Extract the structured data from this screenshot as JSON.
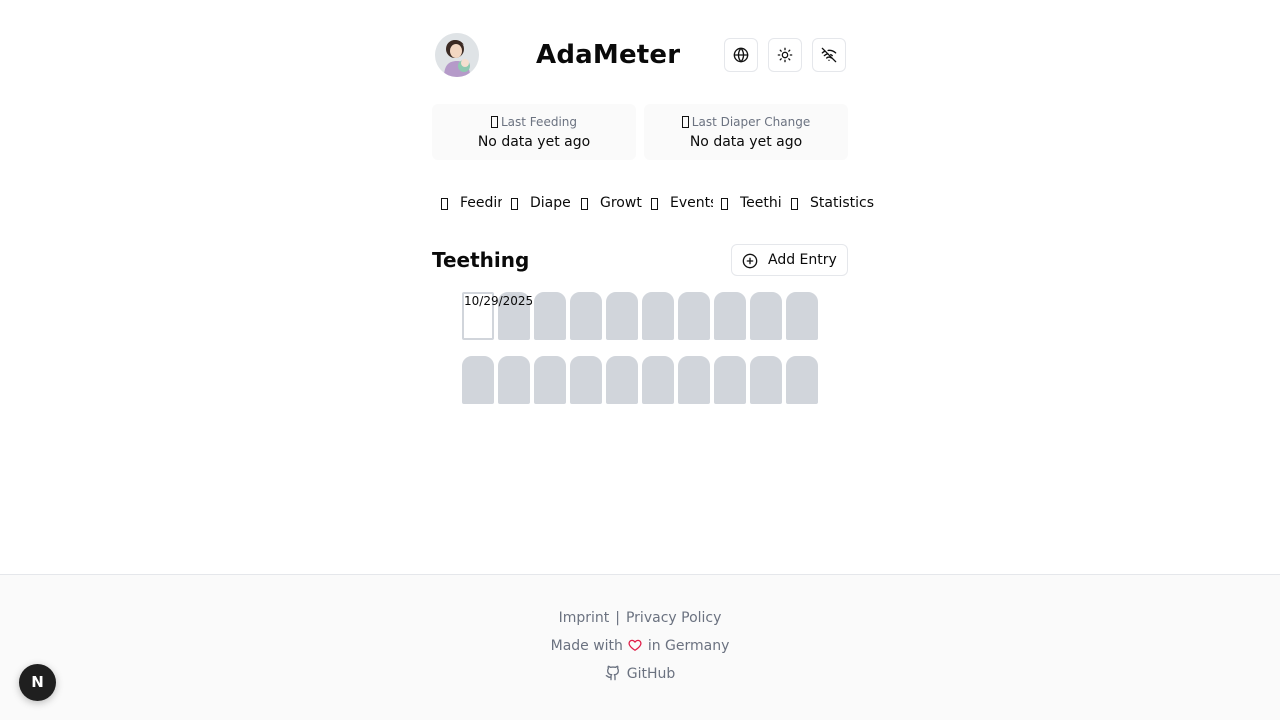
{
  "header": {
    "title": "AdaMeter",
    "avatar_icon": "mother-with-baby-avatar",
    "buttons": [
      {
        "name": "language",
        "icon": "globe-icon"
      },
      {
        "name": "theme",
        "icon": "sun-icon"
      },
      {
        "name": "offline",
        "icon": "wifi-off-icon"
      }
    ]
  },
  "status": {
    "feeding": {
      "label": "Last Feeding",
      "value": "No data yet ago"
    },
    "diaper": {
      "label": "Last Diaper Change",
      "value": "No data yet ago"
    }
  },
  "nav": {
    "tabs": [
      {
        "label": "Feedir"
      },
      {
        "label": "Diape"
      },
      {
        "label": "Growt"
      },
      {
        "label": "Events"
      },
      {
        "label": "Teethi"
      },
      {
        "label": "Statistics"
      }
    ]
  },
  "section": {
    "title": "Teething",
    "add_label": "Add Entry"
  },
  "teeth": {
    "upper_count": 10,
    "lower_count": 10,
    "date_label": "10/29/2025",
    "erupted_index": 0,
    "colors": {
      "tooth": "#d1d5db",
      "erupted": "#ffffff"
    }
  },
  "footer": {
    "imprint": "Imprint",
    "separator": "|",
    "privacy": "Privacy Policy",
    "made_with_prefix": "Made with",
    "made_with_suffix": "in Germany",
    "github": "GitHub",
    "heart_color": "#e11d48"
  },
  "dev_badge": {
    "label": "N"
  }
}
